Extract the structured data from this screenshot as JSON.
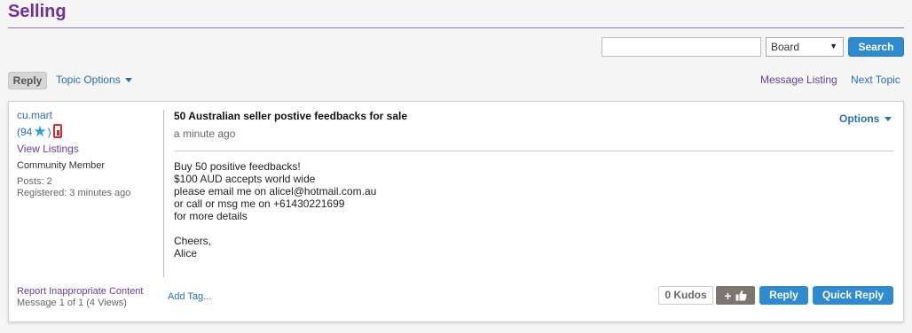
{
  "page": {
    "title": "Selling"
  },
  "search": {
    "value": "",
    "scope": "Board",
    "button_label": "Search"
  },
  "toolbar": {
    "reply_label": "Reply",
    "topic_options_label": "Topic Options",
    "message_listing_label": "Message Listing",
    "next_topic_label": "Next Topic"
  },
  "author": {
    "name": "cu.mart",
    "rank_open": "(94",
    "rank_close": ")",
    "view_listings_label": "View Listings",
    "member_type": "Community Member",
    "posts": "Posts: 2",
    "registered": "Registered: 3 minutes ago"
  },
  "post": {
    "subject": "50 Australian seller postive feedbacks for sale",
    "time": "a minute ago",
    "options_label": "Options",
    "body_lines": [
      "Buy 50 positive feedbacks!",
      "$100 AUD accepts world wide",
      "please email me on alicel@hotmail.com.au",
      "or call or msg me on +61430221699",
      "for more details",
      "",
      "Cheers,",
      "Alice"
    ]
  },
  "footer": {
    "report_label": "Report Inappropriate Content",
    "message_count": "Message 1 of 1 (4 Views)",
    "add_tag_label": "Add Tag...",
    "kudos_label": "0 Kudos",
    "kudo_plus": "+",
    "reply_label": "Reply",
    "quick_reply_label": "Quick Reply"
  },
  "colors": {
    "accent": "#2f8bd0",
    "title": "#7030a0",
    "link": "#2c6fb3",
    "visited_link": "#6a3d9a"
  },
  "icons": {
    "star": "star-icon",
    "feedback": "feedback-icon",
    "thumbs_up": "thumbs-up-icon",
    "dropdown": "chevron-down-icon"
  }
}
